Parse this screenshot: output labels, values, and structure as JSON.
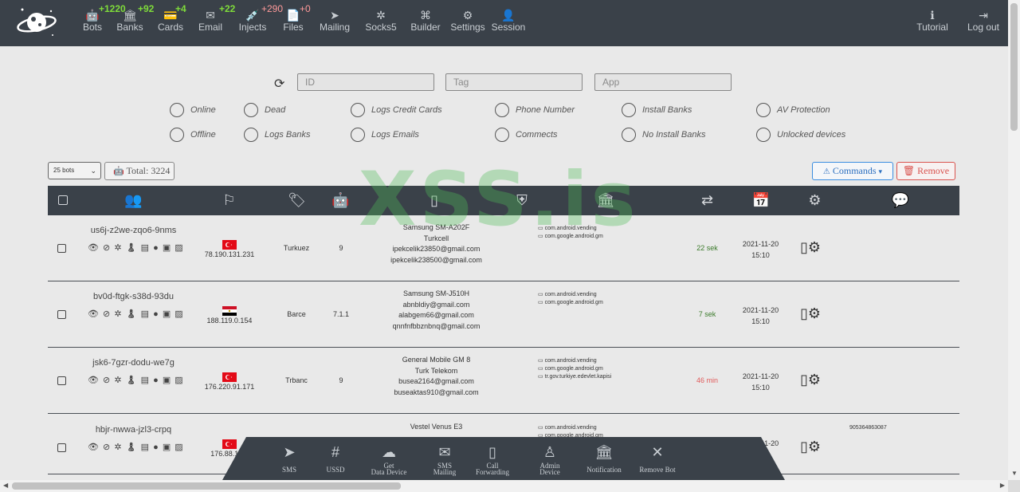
{
  "nav": {
    "items": [
      {
        "label": "Bots",
        "icon": "robot-icon",
        "glyph": "🤖",
        "badge": "+1220",
        "badge_color": "green"
      },
      {
        "label": "Banks",
        "icon": "bank-icon",
        "glyph": "🏛",
        "badge": "+92",
        "badge_color": "green"
      },
      {
        "label": "Cards",
        "icon": "credit-card-icon",
        "glyph": "💳",
        "badge": "+4",
        "badge_color": "green"
      },
      {
        "label": "Email",
        "icon": "envelope-icon",
        "glyph": "✉",
        "badge": "+22",
        "badge_color": "green"
      },
      {
        "label": "Injects",
        "icon": "syringe-icon",
        "glyph": "💉",
        "badge": "+290",
        "badge_color": "red"
      },
      {
        "label": "Files",
        "icon": "file-icon",
        "glyph": "📄",
        "badge": "+0",
        "badge_color": "red"
      },
      {
        "label": "Mailing",
        "icon": "paper-plane-icon",
        "glyph": "➤",
        "badge": "",
        "badge_color": ""
      },
      {
        "label": "Socks5",
        "icon": "network-icon",
        "glyph": "✲",
        "badge": "",
        "badge_color": ""
      },
      {
        "label": "Builder",
        "icon": "builder-icon",
        "glyph": "⌘",
        "badge": "",
        "badge_color": ""
      },
      {
        "label": "Settings",
        "icon": "gears-icon",
        "glyph": "⚙",
        "badge": "",
        "badge_color": ""
      },
      {
        "label": "Session",
        "icon": "user-icon",
        "glyph": "👤",
        "badge": "",
        "badge_color": ""
      }
    ],
    "right": [
      {
        "label": "Tutorial",
        "icon": "info-icon",
        "glyph": "ℹ"
      },
      {
        "label": "Log out",
        "icon": "logout-icon",
        "glyph": "⇥"
      }
    ]
  },
  "filters": {
    "id_placeholder": "ID",
    "tag_placeholder": "Tag",
    "app_placeholder": "App",
    "checkboxes": [
      "Online",
      "Dead",
      "Logs Credit Cards",
      "Phone Number",
      "Install Banks",
      "AV Protection",
      "Offline",
      "Logs Banks",
      "Logs Emails",
      "Commects",
      "No Install Banks",
      "Unlocked devices"
    ]
  },
  "toolbar": {
    "bots_per_page": "25 bots",
    "total": "Total: 3224",
    "commands_label": "Commands",
    "remove_label": "Remove"
  },
  "watermark": "XSS.is",
  "rows": [
    {
      "id": "us6j-z2we-zqo6-9nms",
      "flag": "tr",
      "ip": "78.190.131.231",
      "tag": "Turkuez",
      "version": "9",
      "device_lines": [
        "Samsung SM-A202F",
        "Turkcell",
        "ipekcelik23850@gmail.com",
        "ipekcelik238500@gmail.com"
      ],
      "apps": [
        "com.android.vending",
        "com.google.android.gm"
      ],
      "timeago": "22 sek",
      "timeago_color": "green",
      "date": "2021-11-20",
      "time": "15:10",
      "note": ""
    },
    {
      "id": "bv0d-ftgk-s38d-93du",
      "flag": "eg",
      "ip": "188.119.0.154",
      "tag": "Barce",
      "version": "7.1.1",
      "device_lines": [
        "Samsung SM-J510H",
        "abnbldiy@gmail.com",
        "alabgem66@gmail.com",
        "qnnfnfbbznbnq@gmail.com"
      ],
      "apps": [
        "com.android.vending",
        "com.google.android.gm"
      ],
      "timeago": "7 sek",
      "timeago_color": "green",
      "date": "2021-11-20",
      "time": "15:10",
      "note": ""
    },
    {
      "id": "jsk6-7gzr-dodu-we7g",
      "flag": "tr",
      "ip": "176.220.91.171",
      "tag": "Trbanc",
      "version": "9",
      "device_lines": [
        "General Mobile GM 8",
        "Turk Telekom",
        "busea2164@gmail.com",
        "buseaktas910@gmail.com"
      ],
      "apps": [
        "com.android.vending",
        "com.google.android.gm",
        "tr.gov.turkiye.edevlet.kapisi"
      ],
      "timeago": "46 min",
      "timeago_color": "red",
      "date": "2021-11-20",
      "time": "15:10",
      "note": ""
    },
    {
      "id": "hbjr-nwwa-jzl3-crpq",
      "flag": "tr",
      "ip": "176.88.120.",
      "tag": "",
      "version": "",
      "device_lines": [
        "Vestel Venus E3"
      ],
      "apps": [
        "com.android.vending",
        "com.google.android.gm"
      ],
      "timeago": "",
      "timeago_color": "green",
      "date": "2021-11-20",
      "time": "15:10",
      "note": "905364863087"
    }
  ],
  "actionbar": [
    {
      "label": "SMS",
      "icon": "paper-plane-icon",
      "glyph": "➤"
    },
    {
      "label": "USSD",
      "icon": "hash-icon",
      "glyph": "#"
    },
    {
      "label": "Get\nData Device",
      "icon": "cloud-download-icon",
      "glyph": "☁"
    },
    {
      "label": "SMS\nMailing",
      "icon": "envelope-icon",
      "glyph": "✉"
    },
    {
      "label": "Call\nForwarding",
      "icon": "mobile-icon",
      "glyph": "▯"
    },
    {
      "label": "Admin\nDevice",
      "icon": "user-lock-icon",
      "glyph": "♙"
    },
    {
      "label": "Notification",
      "icon": "bank-icon",
      "glyph": "🏛"
    },
    {
      "label": "Remove Bot",
      "icon": "close-icon",
      "glyph": "✕"
    }
  ]
}
